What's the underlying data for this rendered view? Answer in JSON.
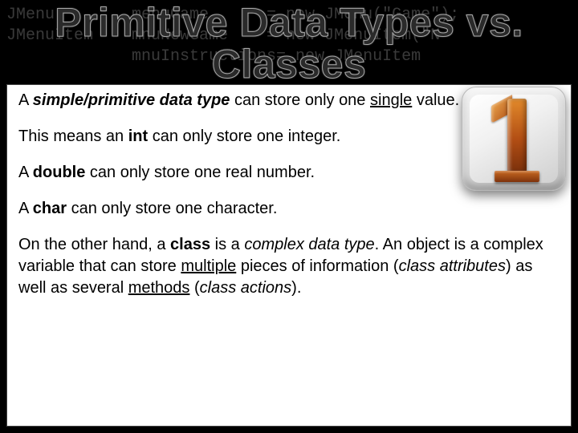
{
  "title": "Primitive Data Types vs. Classes",
  "bg_code": "JMenu        menuGame      = new JMenu(\"Game\");\nJMenuItem    mnuNewGame    = new JMenuItem(\"N\n             mnuInstructions= new JMenuItem\n\n\n\n\n\n\n\n\n\n\n\n\n\n             NewGamedo     mnuNewGame    = new",
  "p1": {
    "t1": "A ",
    "t2": "simple/primitive data type",
    "t3": " can store only one ",
    "t4": "single",
    "t5": " value."
  },
  "p2": {
    "t1": "This means an ",
    "t2": "int",
    "t3": " can only store one integer."
  },
  "p3": {
    "t1": "A ",
    "t2": "double",
    "t3": " can only store one real number."
  },
  "p4": {
    "t1": "A ",
    "t2": "char",
    "t3": " can only store one character."
  },
  "p5": {
    "t1": "On the other hand, a ",
    "t2": "class",
    "t3": " is a ",
    "t4": "complex data type",
    "t5": ". An object is a complex variable that can store ",
    "t6": "multiple",
    "t7": " pieces of information (",
    "t8": "class attributes",
    "t9": ") as well as several ",
    "t10": "methods",
    "t11": " (",
    "t12": "class actions",
    "t13": ")."
  }
}
